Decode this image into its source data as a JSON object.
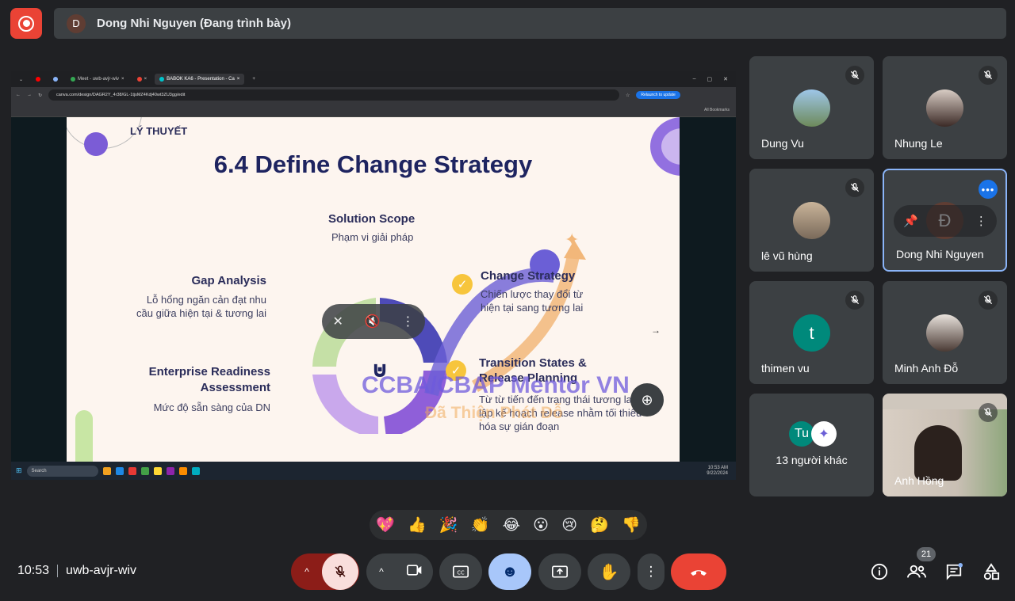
{
  "top_bar": {
    "presenter_initial": "D",
    "presenter_label": "Dong Nhi Nguyen (Đang trình bày)"
  },
  "browser": {
    "tabs": [
      "Meet - uwb-avjr-wiv",
      "BABOK KA6 - Presentation - Ca"
    ],
    "url": "canva.com/design/DAGR2Y_4r38/GL-1tjsMZ4Kdj40wt3ZU3gg/edit",
    "relaunch_label": "Relaunch to update",
    "bookmarks_label": "All Bookmarks"
  },
  "slide": {
    "section": "LÝ THUYẾT",
    "title": "6.4 Define Change Strategy",
    "solution_scope_title": "Solution Scope",
    "solution_scope_desc": "Phạm vi giải pháp",
    "gap_title": "Gap Analysis",
    "gap_desc_1": "Lỗ hổng ngăn cản đạt nhu",
    "gap_desc_2": "cầu giữa hiện tại & tương lai",
    "readiness_title_1": "Enterprise Readiness",
    "readiness_title_2": "Assessment",
    "readiness_desc": "Mức độ sẵn sàng của DN",
    "change_title": "Change Strategy",
    "change_desc_1": "Chiến lược thay đổi từ",
    "change_desc_2": "hiện tại sang tương lai",
    "transition_title_1": "Transition States &",
    "transition_title_2": "Release Planning",
    "transition_desc_1": "Từ từ tiến đến trạng thái tương lai,",
    "transition_desc_2": "lập kế hoạch release nhằm tối thiểu",
    "transition_desc_3": "hóa sự gián đoạn",
    "watermark_1": "CCBA/CBAP Mentor VN",
    "watermark_2": "Đã Thiện Phát Đỗ"
  },
  "taskbar": {
    "search": "Search",
    "time": "10:53 AM",
    "date": "9/22/2024"
  },
  "participants": [
    {
      "name": "Dung Vu",
      "muted": true
    },
    {
      "name": "Nhung Le",
      "muted": true
    },
    {
      "name": "lê vũ hùng",
      "muted": true
    },
    {
      "name": "Dong Nhi Nguyen",
      "muted": false,
      "initial": "Đ"
    },
    {
      "name": "thimen vu",
      "muted": true,
      "initial": "t"
    },
    {
      "name": "Minh Anh Đỗ",
      "muted": true
    },
    {
      "name": "13 người khác",
      "initial": "Tu"
    },
    {
      "name": "Anh Hồng",
      "muted": true
    }
  ],
  "reactions": [
    "💖",
    "👍",
    "🎉",
    "👏",
    "😂",
    "😮",
    "😢",
    "🤔",
    "👎"
  ],
  "bottom": {
    "time": "10:53",
    "meeting_code": "uwb-avjr-wiv",
    "participant_count": "21"
  },
  "colors": {
    "end_call": "#ea4335",
    "active": "#8ab4f8",
    "accent": "#1a73e8"
  }
}
